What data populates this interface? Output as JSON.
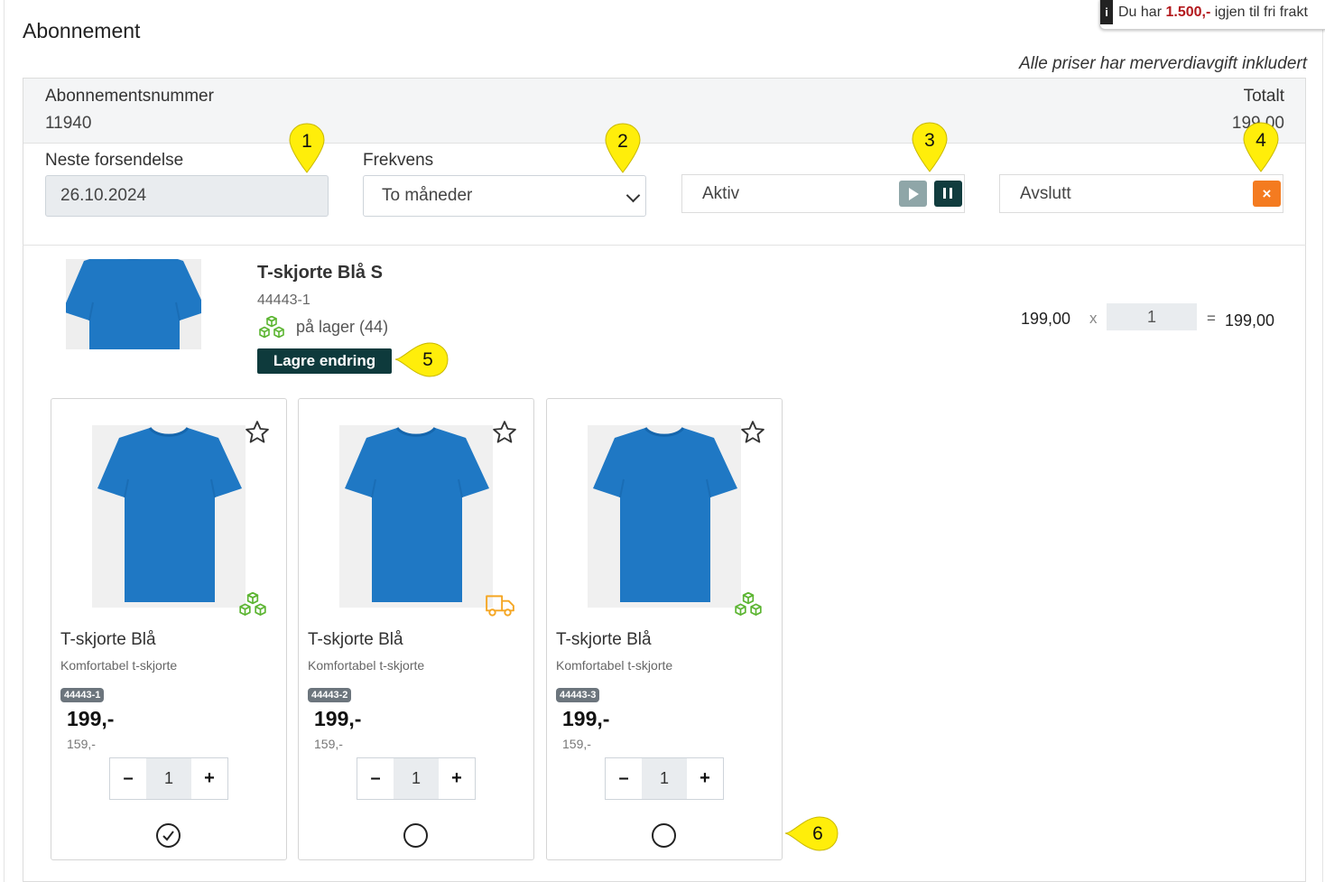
{
  "page": {
    "title": "Abonnement",
    "vat_note": "Alle priser har merverdiavgift inkludert"
  },
  "shipping_note": {
    "prefix": "Du har",
    "amount": "1.500,-",
    "suffix": "igjen til fri frakt"
  },
  "subscription": {
    "number_label": "Abonnementsnummer",
    "number_value": "11940",
    "total_label": "Totalt",
    "total_value": "199,00",
    "next_shipment_label": "Neste forsendelse",
    "next_shipment_value": "26.10.2024",
    "frequency_label": "Frekvens",
    "frequency_value": "To måneder",
    "status_label": "Aktiv",
    "cancel_label": "Avslutt",
    "cancel_symbol": "×"
  },
  "product": {
    "name": "T-skjorte Blå S",
    "sku": "44443-1",
    "stock_text": "på lager (44)",
    "save_label": "Lagre endring",
    "unit_price": "199,00",
    "times": "x",
    "quantity": "1",
    "equals": "=",
    "line_total": "199,00"
  },
  "variants": [
    {
      "name": "T-skjorte Blå",
      "desc": "Komfortabel t-skjorte",
      "sku": "44443-1",
      "price": "199,-",
      "old_price": "159,-",
      "qty": "1",
      "status_icon": "in-stock-icon",
      "selected": true
    },
    {
      "name": "T-skjorte Blå",
      "desc": "Komfortabel t-skjorte",
      "sku": "44443-2",
      "price": "199,-",
      "old_price": "159,-",
      "qty": "1",
      "status_icon": "delivery-truck-icon",
      "selected": false
    },
    {
      "name": "T-skjorte Blå",
      "desc": "Komfortabel t-skjorte",
      "sku": "44443-3",
      "price": "199,-",
      "old_price": "159,-",
      "qty": "1",
      "status_icon": "in-stock-icon",
      "selected": false
    }
  ],
  "stepper": {
    "minus": "–",
    "plus": "+"
  },
  "markers": [
    "1",
    "2",
    "3",
    "4",
    "5",
    "6"
  ],
  "colors": {
    "accent_dark": "#0e3a3c",
    "cancel_orange": "#f47b20",
    "stock_green": "#5cb532",
    "delivery_orange": "#f5a623",
    "marker_yellow": "#ffee0a",
    "shirt_blue": "#1f78c4"
  }
}
